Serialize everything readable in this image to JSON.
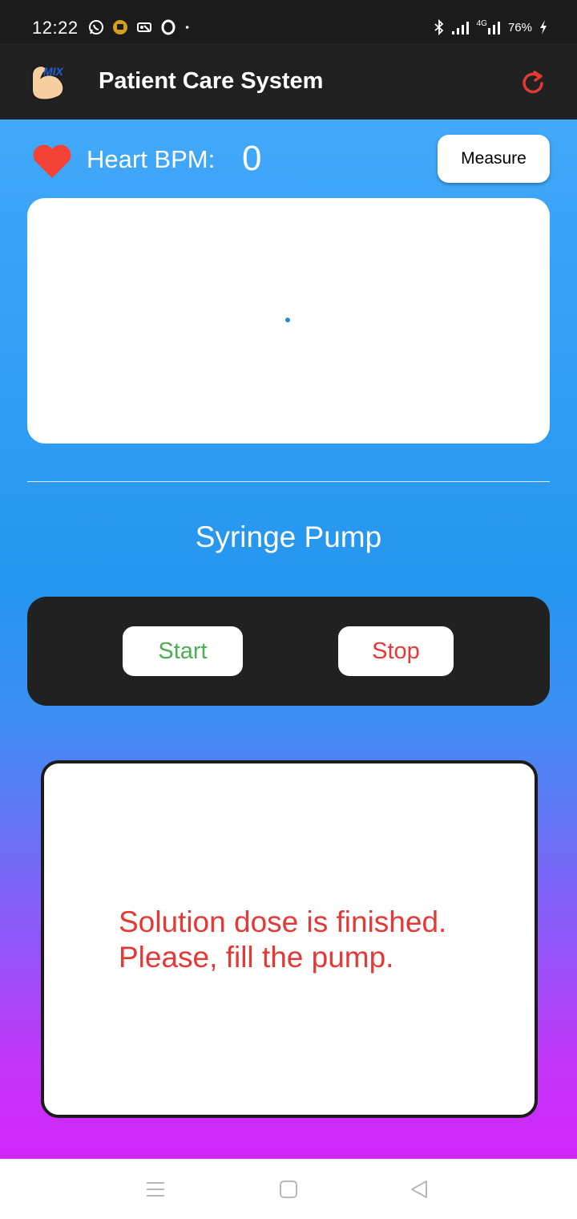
{
  "status_bar": {
    "time": "12:22",
    "battery": "76%",
    "network": "4G",
    "icons_left": [
      "whatsapp-icon",
      "notification-icon",
      "vpn-key-icon",
      "opera-icon",
      "dot-icon"
    ],
    "icons_right": [
      "bluetooth-icon",
      "signal-icon",
      "signal-4g-icon",
      "battery-charging-icon"
    ]
  },
  "app_bar": {
    "logo_icon": "muscle-mix-logo",
    "title": "Patient Care System",
    "refresh_icon": "refresh-icon",
    "refresh_color": "#e53935"
  },
  "heart": {
    "icon": "heart-icon",
    "icon_color": "#f44336",
    "label": "Heart BPM:",
    "value": "0",
    "measure_label": "Measure"
  },
  "syringe": {
    "title": "Syringe Pump",
    "start_label": "Start",
    "start_color": "#4caf50",
    "stop_label": "Stop",
    "stop_color": "#e53935"
  },
  "message": {
    "line1": "Solution dose is finished.",
    "line2": "Please, fill the pump.",
    "color": "#e53935"
  },
  "nav_bar": {
    "icons": [
      "menu-icon",
      "home-icon",
      "back-icon"
    ]
  },
  "colors": {
    "gradient_top": "#42a8fa",
    "gradient_bottom": "#d126fb",
    "app_bar": "#212121"
  }
}
